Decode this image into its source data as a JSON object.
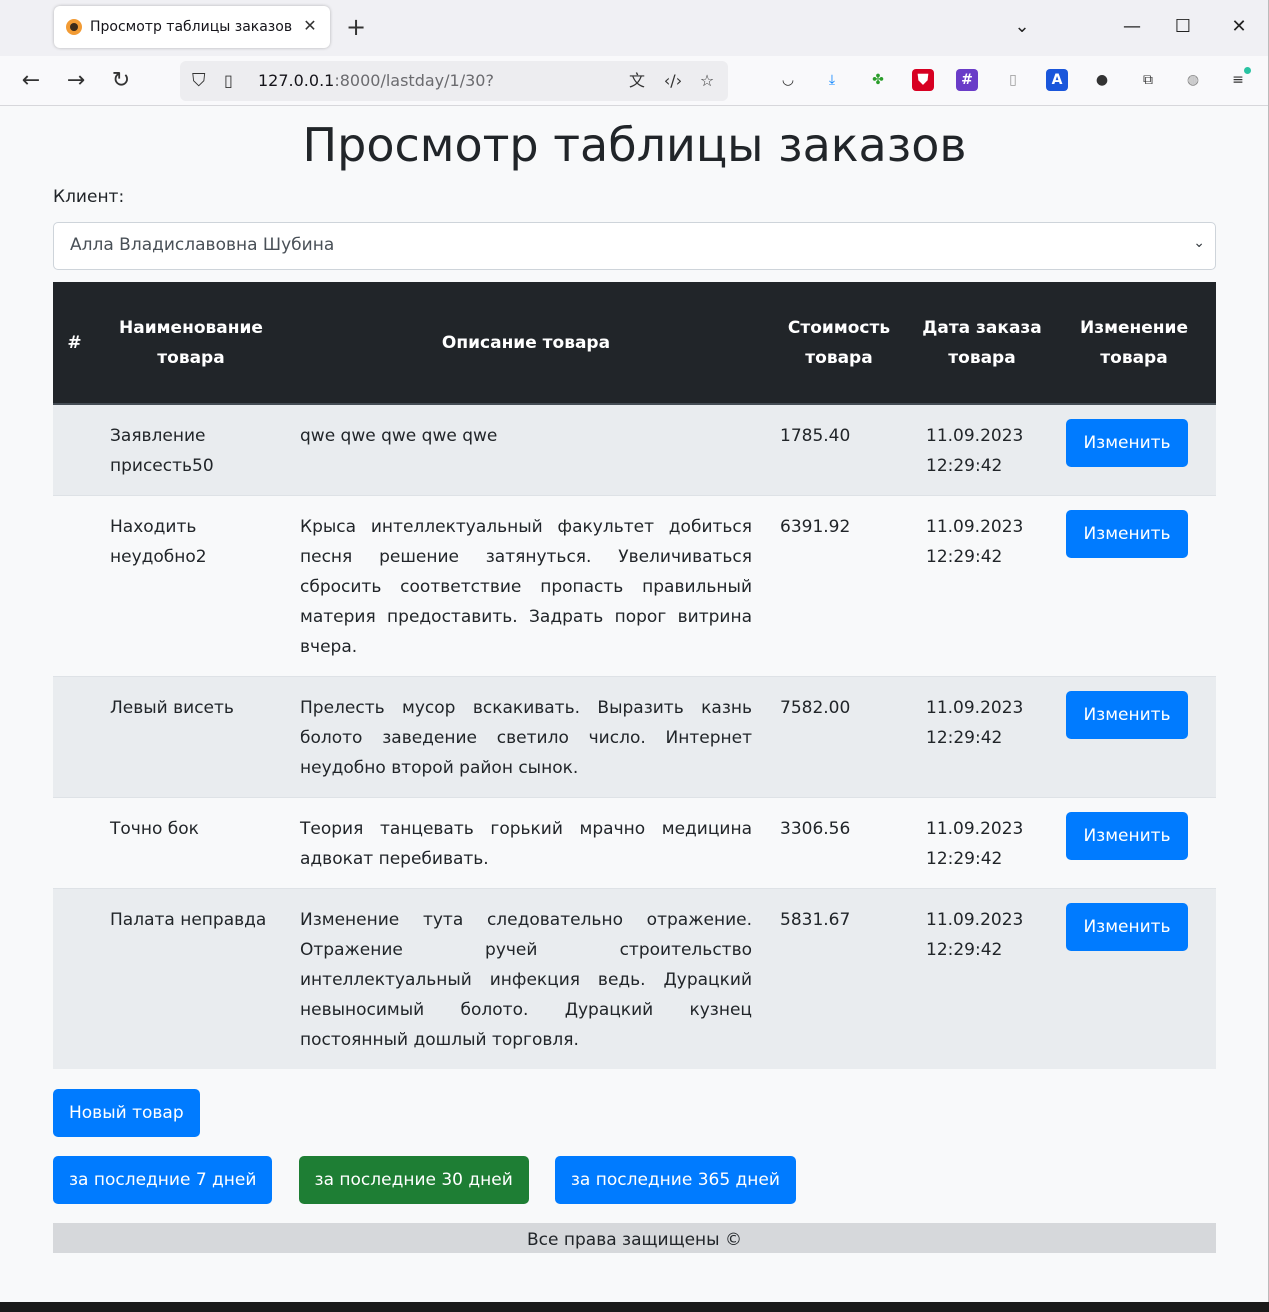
{
  "browser": {
    "tab_title": "Просмотр таблицы заказов",
    "url_host": "127.0.0.1",
    "url_rest": ":8000/lastday/1/30?"
  },
  "page": {
    "title": "Просмотр таблицы заказов",
    "client_label": "Клиент:",
    "client_selected": "Алла Владиславовна Шубина"
  },
  "table": {
    "headers": {
      "num": "#",
      "name": "Наименование товара",
      "description": "Описание товара",
      "price": "Стоимость товара",
      "date": "Дата заказа товара",
      "edit": "Изменение товара"
    },
    "rows": [
      {
        "name": "Заявление присесть50",
        "description": "qwe qwe qwe qwe qwe",
        "price": "1785.40",
        "date": "11.09.2023 12:29:42",
        "edit_label": "Изменить"
      },
      {
        "name": "Находить неудобно2",
        "description": "Крыса интеллектуальный факультет добиться песня решение затянуться. Увеличиваться сбросить соответствие пропасть правильный материя предоставить. Задрать порог витрина вчера.",
        "price": "6391.92",
        "date": "11.09.2023 12:29:42",
        "edit_label": "Изменить"
      },
      {
        "name": "Левый висеть",
        "description": "Прелесть мусор вскакивать. Выразить казнь болото заведение светило число. Интернет неудобно второй район сынок.",
        "price": "7582.00",
        "date": "11.09.2023 12:29:42",
        "edit_label": "Изменить"
      },
      {
        "name": "Точно бок",
        "description": "Теория танцевать горький мрачно медицина адвокат перебивать.",
        "price": "3306.56",
        "date": "11.09.2023 12:29:42",
        "edit_label": "Изменить"
      },
      {
        "name": "Палата неправда",
        "description": "Изменение тута следовательно отражение. Отражение ручей строительство интеллектуальный инфекция ведь. Дурацкий невыносимый болото. Дурацкий кузнец постоянный дошлый торговля.",
        "price": "5831.67",
        "date": "11.09.2023 12:29:42",
        "edit_label": "Изменить"
      }
    ]
  },
  "actions": {
    "new_item": "Новый товар",
    "period_7": "за последние 7 дней",
    "period_30": "за последние 30 дней",
    "period_365": "за последние 365 дней"
  },
  "footer": {
    "text": "Все права защищены ©"
  },
  "colors": {
    "primary": "#007bff",
    "success": "#1e7e34",
    "table_header": "#212529",
    "footer_bg": "#d6d8db"
  }
}
